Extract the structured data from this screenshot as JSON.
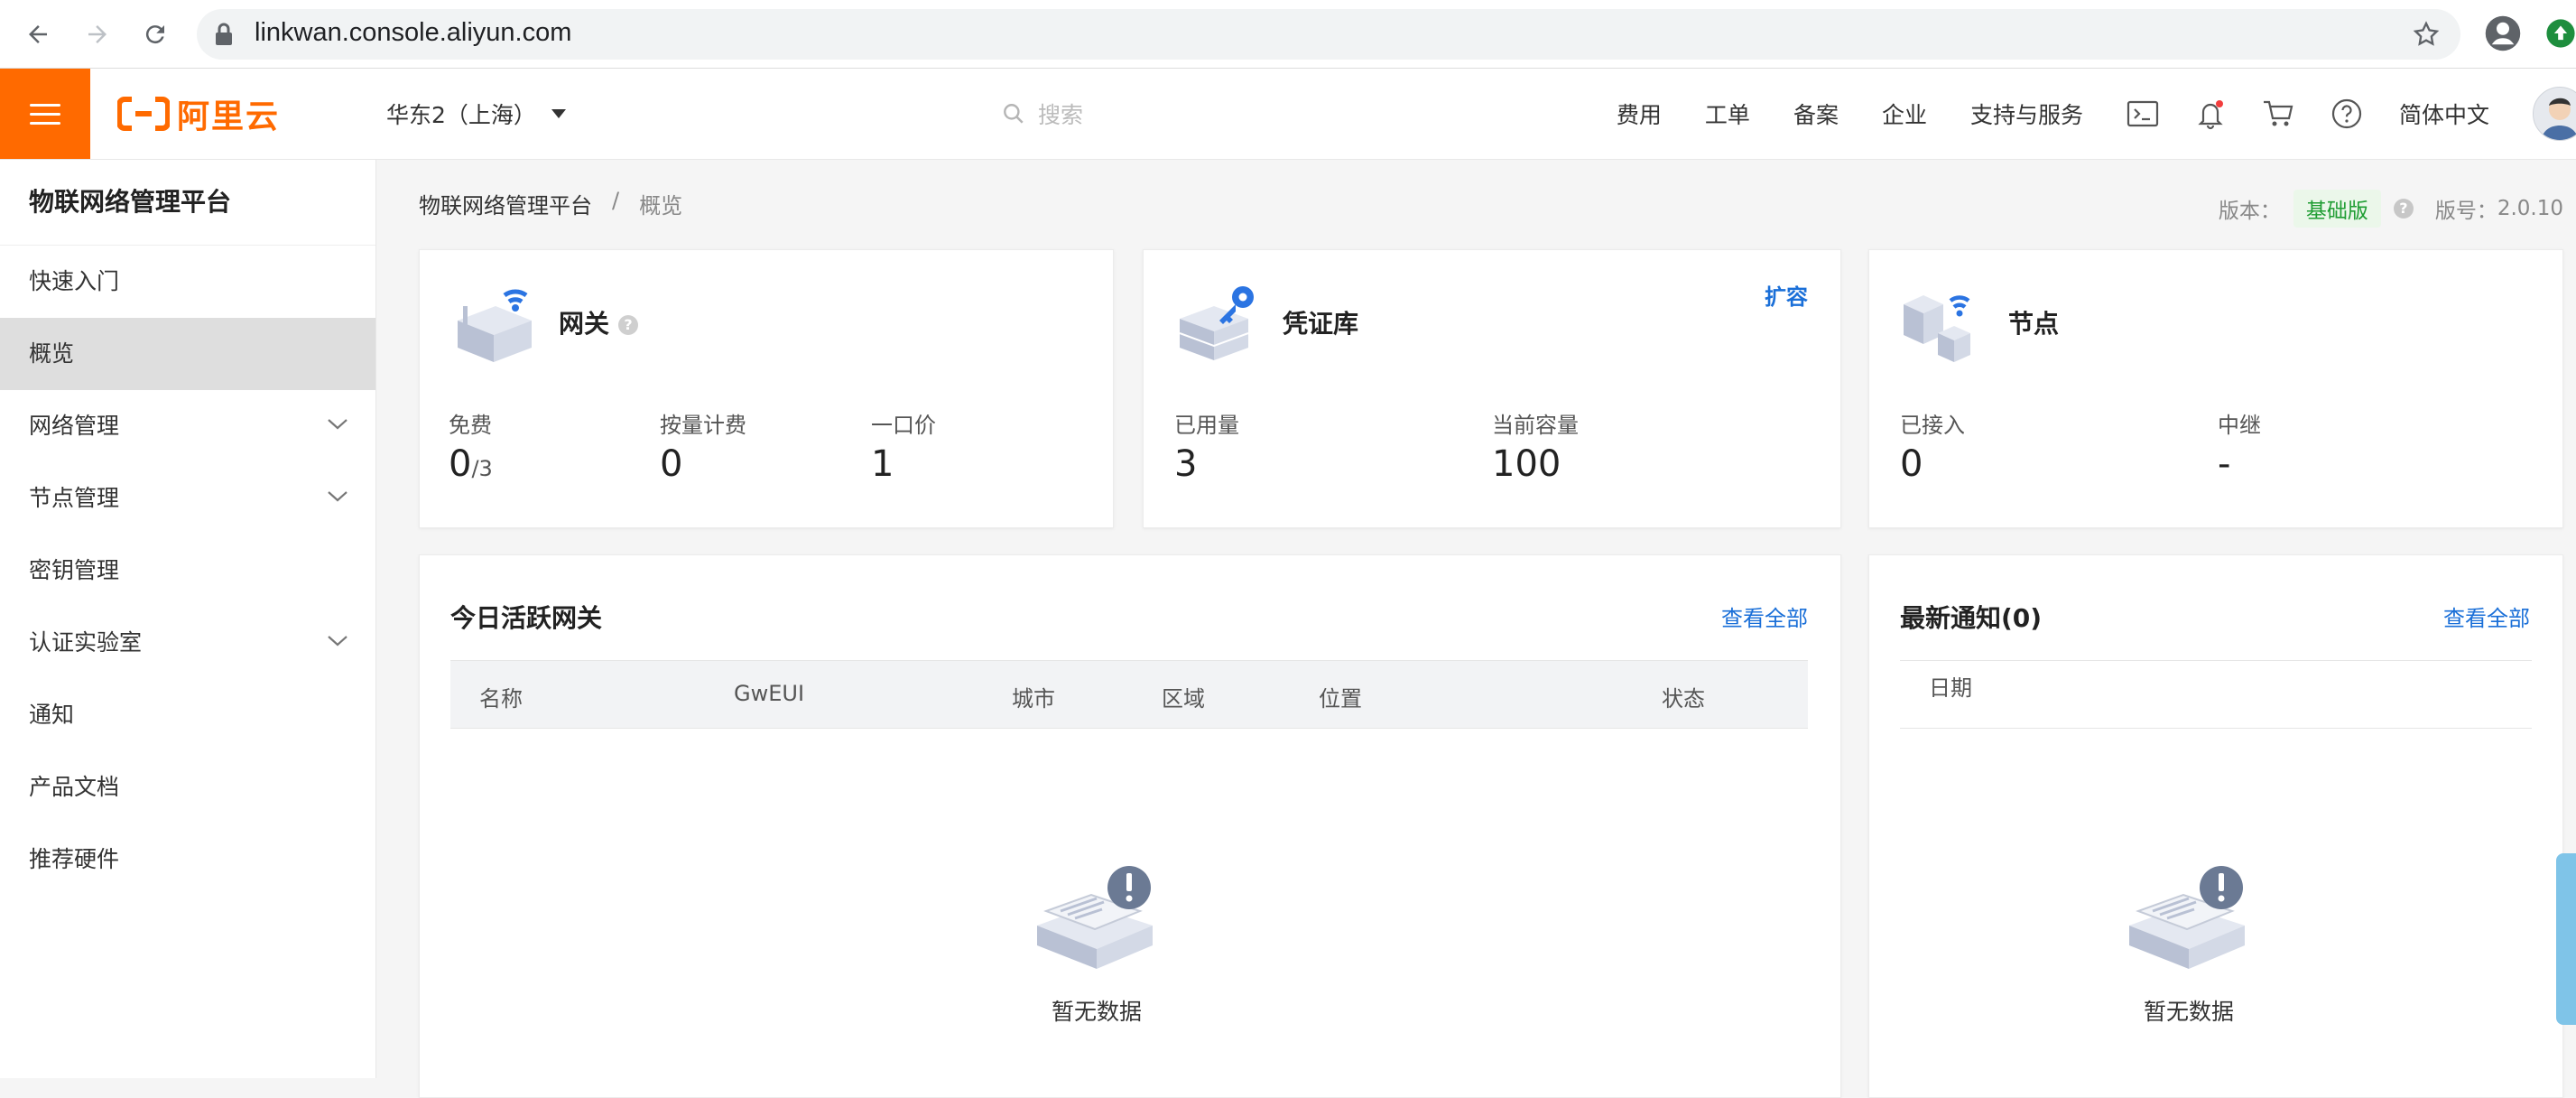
{
  "browser": {
    "url": "linkwan.console.aliyun.com"
  },
  "topnav": {
    "logo_text": "阿里云",
    "region": "华东2（上海）",
    "search_placeholder": "搜索",
    "links": [
      "费用",
      "工单",
      "备案",
      "企业",
      "支持与服务"
    ],
    "language": "简体中文",
    "brand_color": "#ff6a00"
  },
  "sidebar": {
    "title": "物联网络管理平台",
    "items": [
      {
        "label": "快速入门",
        "expandable": false
      },
      {
        "label": "概览",
        "expandable": false,
        "active": true
      },
      {
        "label": "网络管理",
        "expandable": true
      },
      {
        "label": "节点管理",
        "expandable": true
      },
      {
        "label": "密钥管理",
        "expandable": false
      },
      {
        "label": "认证实验室",
        "expandable": true
      },
      {
        "label": "通知",
        "expandable": false
      },
      {
        "label": "产品文档",
        "expandable": false
      },
      {
        "label": "推荐硬件",
        "expandable": false
      }
    ]
  },
  "breadcrumb": {
    "root": "物联网络管理平台",
    "separator": "/",
    "current": "概览"
  },
  "version": {
    "edition_label": "版本：",
    "edition": "基础版",
    "number_label": "版号：",
    "number": "2.0.10"
  },
  "cards": {
    "gateway": {
      "title": "网关",
      "free_label": "免费",
      "free_value": "0",
      "free_total": "/3",
      "usage_label": "按量计费",
      "usage_value": "0",
      "fixed_label": "一口价",
      "fixed_value": "1"
    },
    "credential": {
      "title": "凭证库",
      "action": "扩容",
      "used_label": "已用量",
      "used_value": "3",
      "capacity_label": "当前容量",
      "capacity_value": "100"
    },
    "node": {
      "title": "节点",
      "connected_label": "已接入",
      "connected_value": "0",
      "relay_label": "中继",
      "relay_value": "-"
    }
  },
  "active_gateways": {
    "title": "今日活跃网关",
    "view_all": "查看全部",
    "columns": [
      "名称",
      "GwEUI",
      "城市",
      "区域",
      "位置",
      "状态"
    ],
    "empty_text": "暂无数据"
  },
  "notifications": {
    "title": "最新通知(0)",
    "view_all": "查看全部",
    "columns": [
      "日期"
    ],
    "empty_text": "暂无数据"
  }
}
